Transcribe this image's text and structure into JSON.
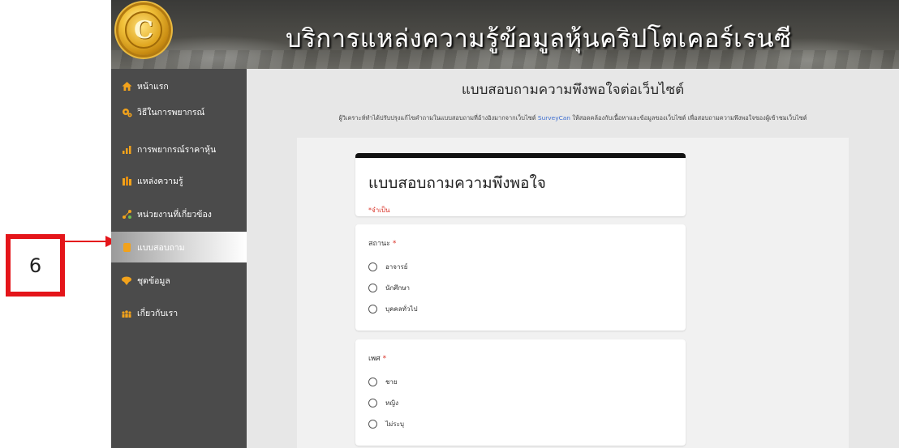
{
  "annotation": {
    "number": "6",
    "color": "#e4151a"
  },
  "header": {
    "logo_letter": "C",
    "site_title": "บริการแหล่งความรู้ข้อมูลหุ้นคริปโตเคอร์เรนซี"
  },
  "sidebar": {
    "items": [
      {
        "label": "หน้าแรก",
        "icon": "home-icon",
        "active": false
      },
      {
        "label": "วิธีในการพยากรณ์",
        "icon": "gears-icon",
        "active": false
      },
      {
        "label": "การพยากรณ์ราคาหุ้น",
        "icon": "bar-chart-icon",
        "active": false
      },
      {
        "label": "แหล่งความรู้",
        "icon": "books-icon",
        "active": false
      },
      {
        "label": "หน่วยงานที่เกี่ยวข้อง",
        "icon": "network-icon",
        "active": false
      },
      {
        "label": "แบบสอบถาม",
        "icon": "survey-icon",
        "active": true
      },
      {
        "label": "ชุดข้อมูล",
        "icon": "data-icon",
        "active": false
      },
      {
        "label": "เกี่ยวกับเรา",
        "icon": "people-icon",
        "active": false
      }
    ]
  },
  "main": {
    "title": "แบบสอบถามความพึงพอใจต่อเว็บไซต์",
    "description_before": "ผู้วิเคราะห์ทำได้ปรับปรุงแก้ไขคำถามในแบบสอบถามที่อ้างอิงมากจากเว็บไซต์ ",
    "description_link": "SurveyCan",
    "description_after": " ให้สอดคล้องกับเนื้อหาและข้อมูลของเว็บไซต์ เพื่อสอบถามความพึงพอใจของผู้เข้าชมเว็บไซต์"
  },
  "form": {
    "title": "แบบสอบถามความพึงพอใจ",
    "required_note": "*จำเป็น",
    "questions": [
      {
        "title": "สถานะ",
        "required_mark": "*",
        "options": [
          "อาจารย์",
          "นักศึกษา",
          "บุคคลทั่วไป"
        ]
      },
      {
        "title": "เพศ",
        "required_mark": "*",
        "options": [
          "ชาย",
          "หญิง",
          "ไม่ระบุ"
        ]
      }
    ]
  },
  "colors": {
    "sidebar_bg": "#4b4b4b",
    "content_bg": "#e7e7e7",
    "link": "#3f6fd0",
    "required": "#d93025",
    "icon_accent": "#f2a21b"
  }
}
